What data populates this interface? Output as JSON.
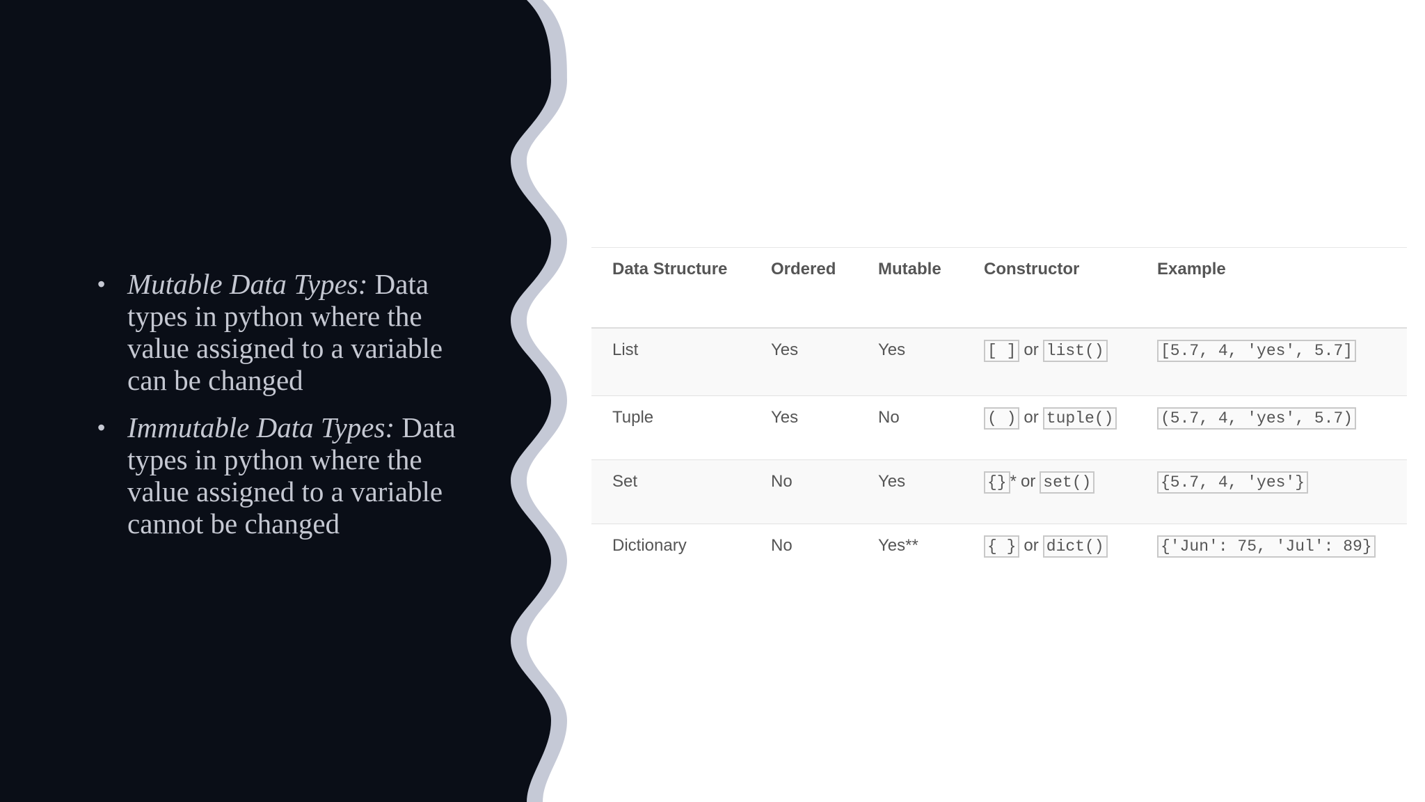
{
  "colors": {
    "left_panel": "#0a0e17",
    "wave_border": "#c5c9d6",
    "text_light": "#c5c8d2",
    "table_text": "#555555"
  },
  "bullets": [
    {
      "term": "Mutable Data Types:",
      "text": " Data types in python where the value assigned to a variable can be changed"
    },
    {
      "term": "Immutable Data Types:",
      "text": " Data types in python where the value assigned to a variable cannot be changed"
    }
  ],
  "table": {
    "headers": [
      "Data Structure",
      "Ordered",
      "Mutable",
      "Constructor",
      "Example"
    ],
    "rows": [
      {
        "structure": "List",
        "ordered": "Yes",
        "mutable": "Yes",
        "ctor_literal": "[ ]",
        "ctor_suffix": "",
        "ctor_or": "or",
        "ctor_func": "list()",
        "example": "[5.7, 4, 'yes', 5.7]"
      },
      {
        "structure": "Tuple",
        "ordered": "Yes",
        "mutable": "No",
        "ctor_literal": "( )",
        "ctor_suffix": "",
        "ctor_or": "or",
        "ctor_func": "tuple()",
        "example": "(5.7, 4, 'yes', 5.7)"
      },
      {
        "structure": "Set",
        "ordered": "No",
        "mutable": "Yes",
        "ctor_literal": "{}",
        "ctor_suffix": "*",
        "ctor_or": "or",
        "ctor_func": "set()",
        "example": "{5.7, 4, 'yes'}"
      },
      {
        "structure": "Dictionary",
        "ordered": "No",
        "mutable": "Yes**",
        "ctor_literal": "{ }",
        "ctor_suffix": "",
        "ctor_or": "or",
        "ctor_func": "dict()",
        "example": "{'Jun': 75, 'Jul': 89}"
      }
    ]
  }
}
